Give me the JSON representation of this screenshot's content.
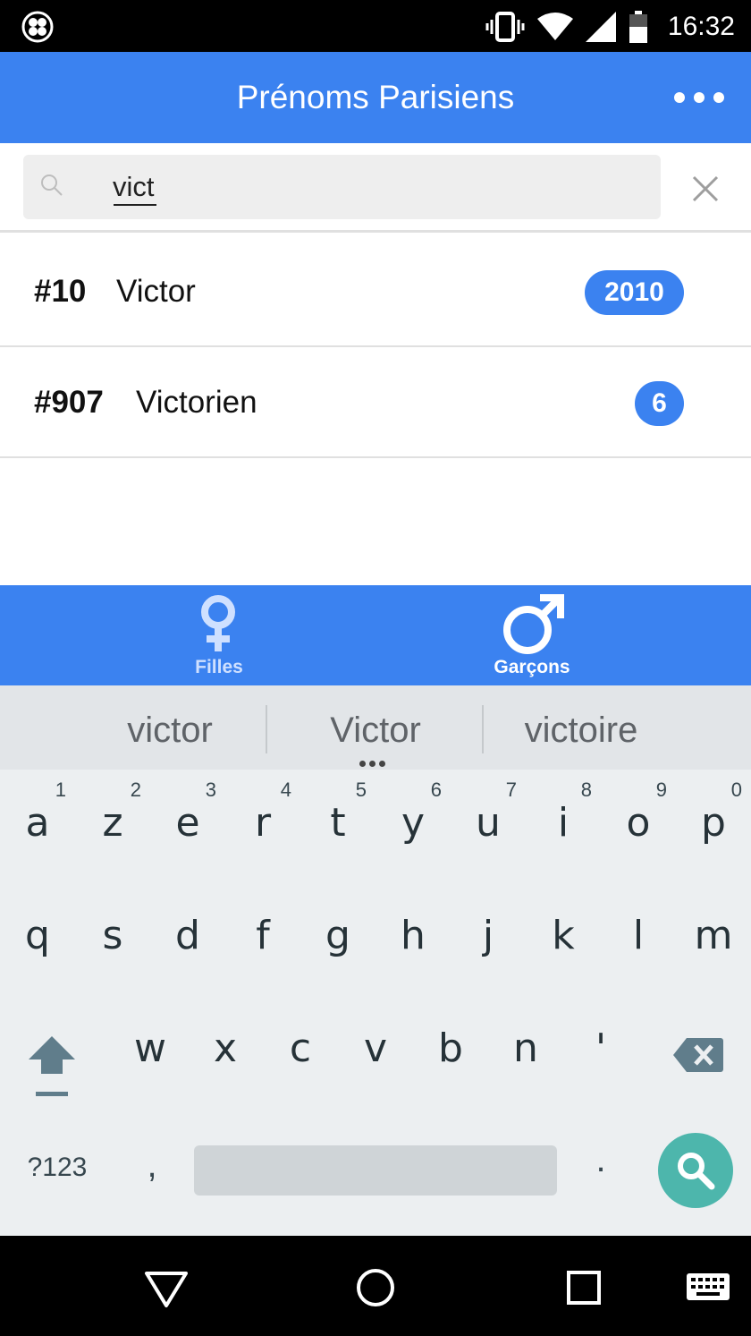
{
  "status_bar": {
    "time": "16:32"
  },
  "app_bar": {
    "title": "Prénoms Parisiens"
  },
  "search": {
    "query": "vict"
  },
  "results": [
    {
      "rank": "#10",
      "name": "Victor",
      "count": "2010"
    },
    {
      "rank": "#907",
      "name": "Victorien",
      "count": "6"
    }
  ],
  "tabs": [
    {
      "label": "Filles",
      "active": false
    },
    {
      "label": "Garçons",
      "active": true
    }
  ],
  "keyboard": {
    "suggestions": [
      "victor",
      "Victor",
      "victoire"
    ],
    "row1": [
      {
        "letter": "a",
        "hint": "1"
      },
      {
        "letter": "z",
        "hint": "2"
      },
      {
        "letter": "e",
        "hint": "3"
      },
      {
        "letter": "r",
        "hint": "4"
      },
      {
        "letter": "t",
        "hint": "5"
      },
      {
        "letter": "y",
        "hint": "6"
      },
      {
        "letter": "u",
        "hint": "7"
      },
      {
        "letter": "i",
        "hint": "8"
      },
      {
        "letter": "o",
        "hint": "9"
      },
      {
        "letter": "p",
        "hint": "0"
      }
    ],
    "row2": [
      "q",
      "s",
      "d",
      "f",
      "g",
      "h",
      "j",
      "k",
      "l",
      "m"
    ],
    "row3": [
      "w",
      "x",
      "c",
      "v",
      "b",
      "n",
      "'"
    ],
    "symbols_label": "?123",
    "comma": ",",
    "period": "."
  },
  "colors": {
    "primary": "#3b82f0",
    "tab_inactive": "#cfe0ff",
    "search_action": "#4db6ac"
  }
}
